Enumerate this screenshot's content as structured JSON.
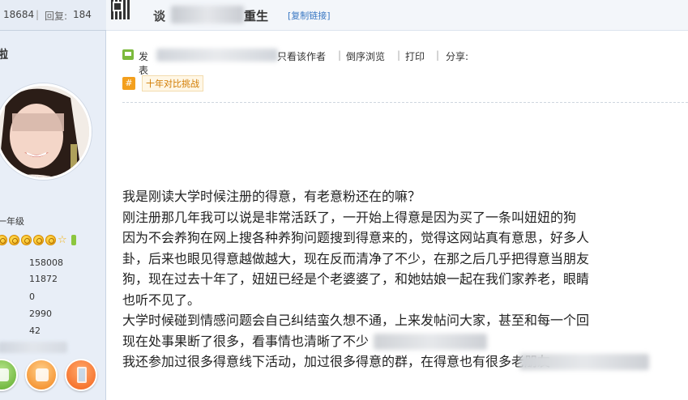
{
  "sidebar": {
    "stats": {
      "views": "18684",
      "separator": "|",
      "reply_label": "回复:",
      "replies": "184"
    },
    "username": "啦",
    "user_level": "一年级",
    "stats_rows": [
      {
        "mark": "",
        "value": "158008"
      },
      {
        "mark": "",
        "value": "11872"
      },
      {
        "mark": "",
        "value": "0"
      },
      {
        "mark": "",
        "value": "2990"
      },
      {
        "mark": "",
        "value": "42"
      }
    ],
    "action_icons": [
      "green-gift-icon",
      "orange-thumb-icon",
      "orange-phone-icon"
    ]
  },
  "header": {
    "title_prefix": "谈",
    "title_suffix": "重生",
    "copy_link": "[复制链接]"
  },
  "author_bar": {
    "author_label": "发表",
    "only_author": "只看该作者",
    "reverse_view": "倒序浏览",
    "print": "打印",
    "share": "分享:",
    "separator": "|"
  },
  "tag": {
    "hash": "#",
    "label": "十年对比挑战"
  },
  "post": {
    "lines": [
      "我是刚读大学时候注册的得意，有老意粉还在的嘛？",
      "刚注册那几年我可以说是非常活跃了，一开始上得意是因为买了一条叫妞妞的狗",
      "因为不会养狗在网上搜各种养狗问题搜到得意来的，觉得这网站真有意思，好多人",
      "卦，后来也眼见得意越做越大，现在反而清净了不少，在那之后几乎把得意当朋友",
      "狗，现在过去十年了，妞妞已经是个老婆婆了，和她姑娘一起在我们家养老，眼睛",
      "也听不见了。",
      "大学时候碰到情感问题会自己纠结蛮久想不通，上来发帖问大家，甚至和每一个回",
      "现在处事果断了很多，看事情也清晰了不少",
      "我还参加过很多得意线下活动，加过很多得意的群，在得意也有很多老朋友"
    ]
  }
}
